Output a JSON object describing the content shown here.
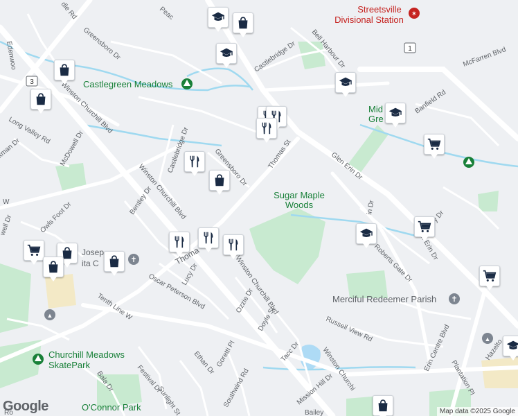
{
  "map": {
    "labels": {
      "streetsville_station": [
        "Streetsville",
        "Divisional Station"
      ],
      "castlegreen": "Castlegreen Meadows",
      "sugar_maple": [
        "Sugar Maple",
        "Woods"
      ],
      "merciful": "Merciful Redeemer Parish",
      "churchill_skate": [
        "Churchill Meadows",
        "SkatePark"
      ],
      "oconnor": "O'Connor Park",
      "mid_green": [
        "Mid",
        "Gre"
      ]
    },
    "streets": {
      "peac": "Peac",
      "greensboro_top": "Greensboro Dr",
      "castlebridge_top": "Castlebridge Dr",
      "bell_harbour": "Bell Harbour Dr",
      "mcfarren": "McFarren Blvd",
      "banfield": "Banfield Rd",
      "winston_top": "Winston Churchill Blvd",
      "long_valley": "Long Valley Rd",
      "mcdowell": "McDowell Dr",
      "castlebridge_mid": "Castlebridge Dr",
      "greensboro_mid": "Greensboro Dr",
      "thomas": "Thomas St",
      "glen_erin_mid": "Glen Erin Dr",
      "glen_erin_right": "Glen Erin Dr",
      "bentley": "Bentley Dr",
      "owls_foot": "Owls Foot Dr",
      "winston_mid": "Winston Churchill Blvd",
      "lucy": "Lucy Dr",
      "oscar": "Oscar Peterson Blvd",
      "tenth_line": "Tenth Line W",
      "ozzie": "Ozzie Dr",
      "winston_low": "Winston Churchill Blvd",
      "doyle": "Doyle St",
      "russell": "Russell View Rd",
      "erin_centre": "Erin Centre Blvd",
      "plantation": "Plantation Pl",
      "tacc": "Tacc Dr",
      "mission_hill": "Mission Hill Dr",
      "winston_bottom": "Winston Churchi",
      "ethan": "Ethan Dr",
      "goretti": "Goretti Pl",
      "southwind": "Southwind Rd",
      "festival": "Festival Dr",
      "bala": "Bala Dr",
      "sunlight": "Sunlight St",
      "hazelton": "Hazelto",
      "roberts_gate": "Roberts Gate Dr",
      "glen_erin_cut": "in Dr",
      "edenwood": "Edenwoo",
      "kman": "kman Dr",
      "pedle": "dle Rd",
      "tenth_dr": "well Dr",
      "joseph": "Josep",
      "ita": "ita C",
      "thoma": "Thoma",
      "shire_w": "W",
      "route_3": "3",
      "route_1": "1",
      "ballybury": "allebury Dr",
      "bottom_1": "Ro",
      "bottom_2": "Bailey"
    },
    "logo": "Google",
    "attribution": "Map data ©2025 Google",
    "colors": {
      "marker_icon": "#1a2b44",
      "park": "#c8ead0",
      "water": "#aedbf5",
      "creek": "#9fd9f0",
      "road": "#ffffff",
      "poi_green": "#188038",
      "poi_red": "#c5221f"
    },
    "markers": [
      {
        "type": "school-icon"
      },
      {
        "type": "shopping-bag-icon"
      },
      {
        "type": "school-icon"
      },
      {
        "type": "shopping-bag-icon"
      },
      {
        "type": "shopping-bag-icon"
      },
      {
        "type": "school-icon"
      },
      {
        "type": "restaurant-icon"
      },
      {
        "type": "restaurant-icon"
      },
      {
        "type": "restaurant-icon"
      },
      {
        "type": "school-icon"
      },
      {
        "type": "shopping-cart-icon"
      },
      {
        "type": "restaurant-icon"
      },
      {
        "type": "shopping-bag-icon"
      },
      {
        "type": "shopping-cart-icon"
      },
      {
        "type": "school-icon"
      },
      {
        "type": "restaurant-icon"
      },
      {
        "type": "restaurant-icon"
      },
      {
        "type": "restaurant-icon"
      },
      {
        "type": "shopping-cart-icon"
      },
      {
        "type": "shopping-bag-icon"
      },
      {
        "type": "shopping-bag-icon"
      },
      {
        "type": "shopping-bag-icon"
      },
      {
        "type": "shopping-cart-icon"
      },
      {
        "type": "school-icon"
      },
      {
        "type": "shopping-bag-icon"
      }
    ]
  }
}
